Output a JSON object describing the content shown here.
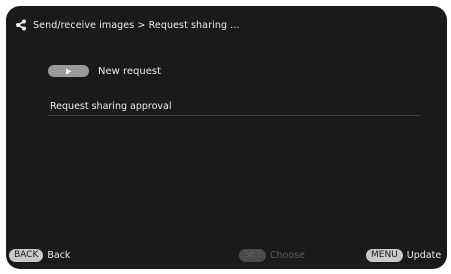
{
  "header": {
    "breadcrumb": "Send/receive images > Request sharing ...",
    "icon": "share-icon"
  },
  "menu": {
    "new_request": {
      "label": "New request",
      "icon": "play-icon"
    },
    "approval_item": {
      "label": "Request sharing approval"
    }
  },
  "footer": {
    "back": {
      "key": "BACK",
      "label": "Back"
    },
    "set": {
      "key": "SET",
      "label": "Choose",
      "enabled": false
    },
    "menu": {
      "key": "MENU",
      "label": "Update"
    }
  },
  "colors": {
    "background": "#1a1a1a",
    "text": "#ececec",
    "key_active": "#c9c9c9",
    "key_disabled": "#4a4a4a"
  }
}
